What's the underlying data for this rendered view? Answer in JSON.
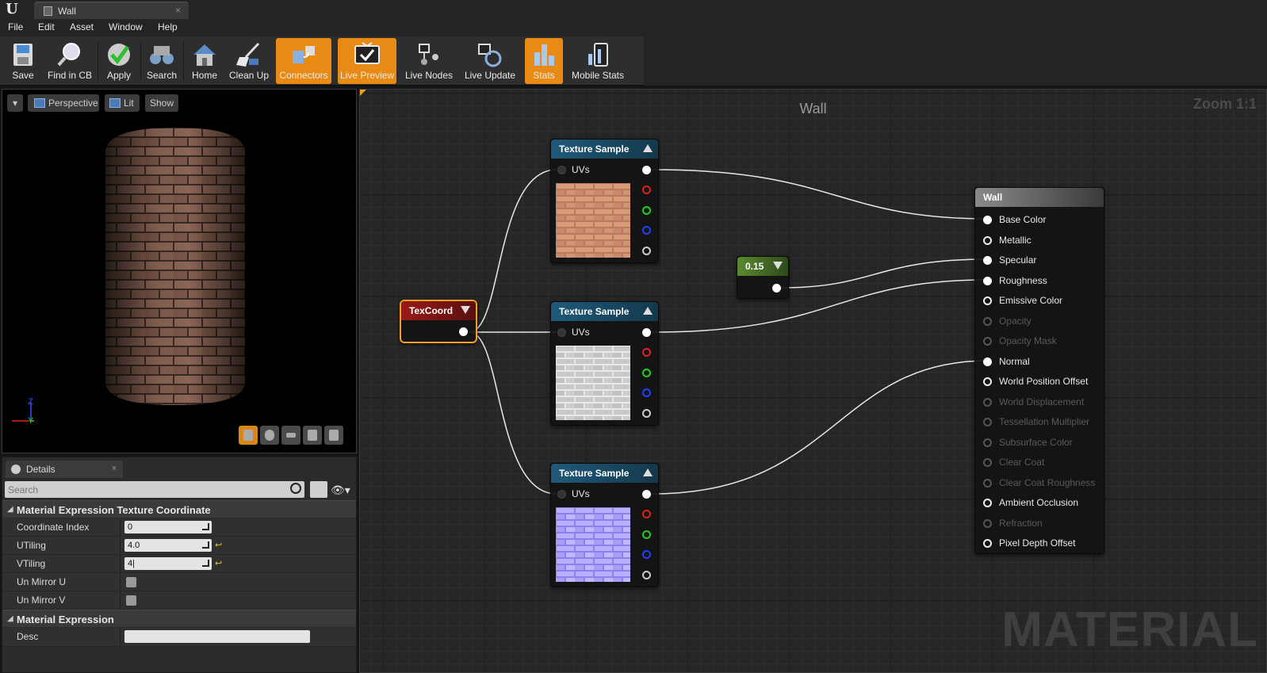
{
  "window": {
    "tab_label": "Wall"
  },
  "menu": [
    "File",
    "Edit",
    "Asset",
    "Window",
    "Help"
  ],
  "toolbar": {
    "buttons": [
      {
        "label": "Save",
        "icon": "save-icon",
        "active": false
      },
      {
        "label": "Find in CB",
        "icon": "magnifier-icon",
        "active": false
      },
      {
        "label": "Apply",
        "icon": "checkmark-icon",
        "active": false
      },
      {
        "label": "Search",
        "icon": "binoculars-icon",
        "active": false
      },
      {
        "label": "Home",
        "icon": "home-icon",
        "active": false
      },
      {
        "label": "Clean Up",
        "icon": "broom-icon",
        "active": false
      },
      {
        "label": "Connectors",
        "icon": "connectors-icon",
        "active": true
      },
      {
        "label": "Live Preview",
        "icon": "tv-icon",
        "active": true
      },
      {
        "label": "Live Nodes",
        "icon": "live-nodes-icon",
        "active": false
      },
      {
        "label": "Live Update",
        "icon": "live-update-icon",
        "active": false
      },
      {
        "label": "Stats",
        "icon": "stats-icon",
        "active": true
      },
      {
        "label": "Mobile Stats",
        "icon": "mobile-stats-icon",
        "active": false
      }
    ]
  },
  "viewport": {
    "perspective_label": "Perspective",
    "lit_label": "Lit",
    "show_label": "Show",
    "axis_z": "Z",
    "axis_y": "Y"
  },
  "details": {
    "tab_label": "Details",
    "search_placeholder": "Search",
    "category1": "Material Expression Texture Coordinate",
    "props": [
      {
        "name": "Coordinate Index",
        "value": "0"
      },
      {
        "name": "UTiling",
        "value": "4.0"
      },
      {
        "name": "VTiling",
        "value": "4|"
      },
      {
        "name": "Un Mirror U"
      },
      {
        "name": "Un Mirror V"
      }
    ],
    "category2": "Material Expression",
    "desc_label": "Desc"
  },
  "graph": {
    "title": "Wall",
    "zoom": "Zoom 1:1",
    "watermark": "MATERIAL",
    "texcoord_title": "TexCoord",
    "texture_sample_title": "Texture Sample",
    "uvs_label": "UVs",
    "constant_value": "0.15",
    "result_node": {
      "title": "Wall",
      "inputs": [
        {
          "label": "Base Color",
          "enabled": true,
          "connected": true
        },
        {
          "label": "Metallic",
          "enabled": true,
          "connected": false
        },
        {
          "label": "Specular",
          "enabled": true,
          "connected": true
        },
        {
          "label": "Roughness",
          "enabled": true,
          "connected": true
        },
        {
          "label": "Emissive Color",
          "enabled": true,
          "connected": false
        },
        {
          "label": "Opacity",
          "enabled": false,
          "connected": false
        },
        {
          "label": "Opacity Mask",
          "enabled": false,
          "connected": false
        },
        {
          "label": "Normal",
          "enabled": true,
          "connected": true
        },
        {
          "label": "World Position Offset",
          "enabled": true,
          "connected": false
        },
        {
          "label": "World Displacement",
          "enabled": false,
          "connected": false
        },
        {
          "label": "Tessellation Multiplier",
          "enabled": false,
          "connected": false
        },
        {
          "label": "Subsurface Color",
          "enabled": false,
          "connected": false
        },
        {
          "label": "Clear Coat",
          "enabled": false,
          "connected": false
        },
        {
          "label": "Clear Coat Roughness",
          "enabled": false,
          "connected": false
        },
        {
          "label": "Ambient Occlusion",
          "enabled": true,
          "connected": false
        },
        {
          "label": "Refraction",
          "enabled": false,
          "connected": false
        },
        {
          "label": "Pixel Depth Offset",
          "enabled": true,
          "connected": false
        }
      ]
    }
  },
  "colors": {
    "accent_orange": "#e88a13",
    "texture_header": "#1f5a7a",
    "texcoord_header": "#8a1818",
    "constant_header": "#4c7a28",
    "result_header": "#6e6e6e"
  }
}
